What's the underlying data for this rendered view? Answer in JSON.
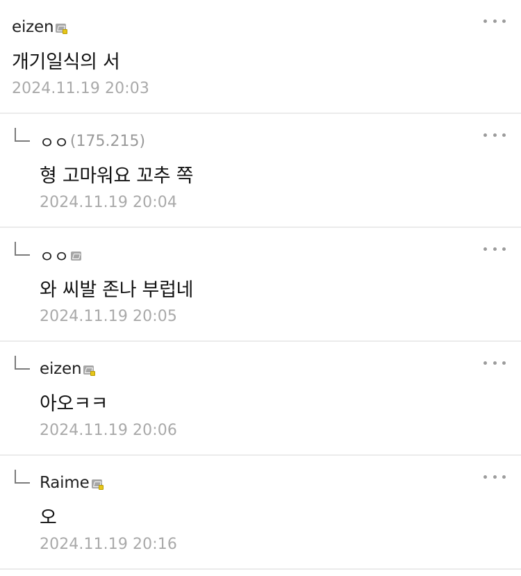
{
  "comments": [
    {
      "author": "eizen",
      "ip": "",
      "badge": "member-badge-gold",
      "text": "개기일식의 서",
      "date": "2024.11.19 20:03",
      "reply": false
    },
    {
      "author": "ㅇㅇ",
      "ip": "(175.215)",
      "badge": "",
      "text": "형 고마워요 꼬추 쪽",
      "date": "2024.11.19 20:04",
      "reply": true
    },
    {
      "author": "ㅇㅇ",
      "ip": "",
      "badge": "member-badge-plain",
      "text": "와 씨발 존나 부럽네",
      "date": "2024.11.19 20:05",
      "reply": true
    },
    {
      "author": "eizen",
      "ip": "",
      "badge": "member-badge-gold",
      "text": "아오ㅋㅋ",
      "date": "2024.11.19 20:06",
      "reply": true
    },
    {
      "author": "Raime",
      "ip": "",
      "badge": "member-badge-gold",
      "text": "오",
      "date": "2024.11.19 20:16",
      "reply": true
    }
  ],
  "icons": {
    "more": "more-options-icon",
    "reply": "reply-arrow-icon"
  },
  "colors": {
    "text": "#111111",
    "date": "#a9a9a9",
    "ip": "#999999",
    "divider": "#ebebeb",
    "badge_gold": "#e6c619"
  }
}
